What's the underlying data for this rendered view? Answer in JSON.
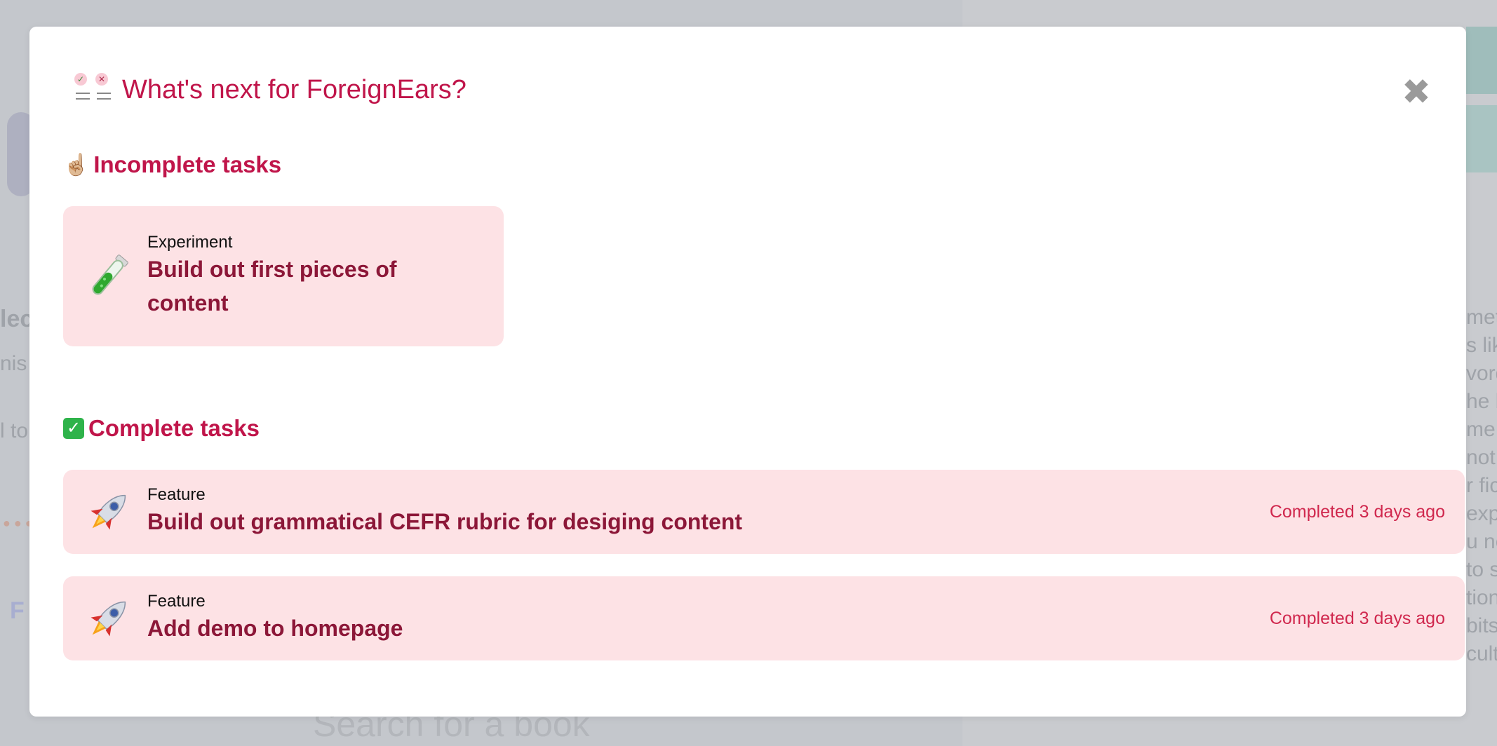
{
  "modal": {
    "title": "What's next for ForeignEars?",
    "close_glyph": "✖",
    "header_icon": "checklist-icon"
  },
  "sections": {
    "incomplete": {
      "emoji": "☝🏼",
      "title": "Incomplete tasks",
      "tasks": [
        {
          "type": "Experiment",
          "name": "Build out first pieces of content",
          "icon": "test-tube-icon",
          "icon_glyph": "🧪"
        }
      ]
    },
    "complete": {
      "emoji": "✓",
      "title": "Complete tasks",
      "tasks": [
        {
          "type": "Feature",
          "name": "Build out grammatical CEFR rubric for desiging content",
          "status": "Completed 3 days ago",
          "icon": "rocket-icon",
          "icon_glyph": "🚀"
        },
        {
          "type": "Feature",
          "name": "Add demo to homepage",
          "status": "Completed 3 days ago",
          "icon": "rocket-icon",
          "icon_glyph": "🚀"
        }
      ]
    }
  },
  "background": {
    "search_placeholder": "Search for a book",
    "right_text_fragments": [
      "met",
      "s lik",
      "vord",
      "he b",
      "me t",
      "not",
      "r fic",
      "exp",
      "u ne",
      "to s",
      "tion",
      "bits",
      "culty"
    ],
    "left_text_fragments": [
      "lec",
      "nis",
      "l to"
    ],
    "left_nav_fragment": "F"
  },
  "colors": {
    "accent": "#c0154a",
    "task_title": "#8c1738",
    "card_bg": "#fde2e5",
    "status": "#d0284e"
  }
}
